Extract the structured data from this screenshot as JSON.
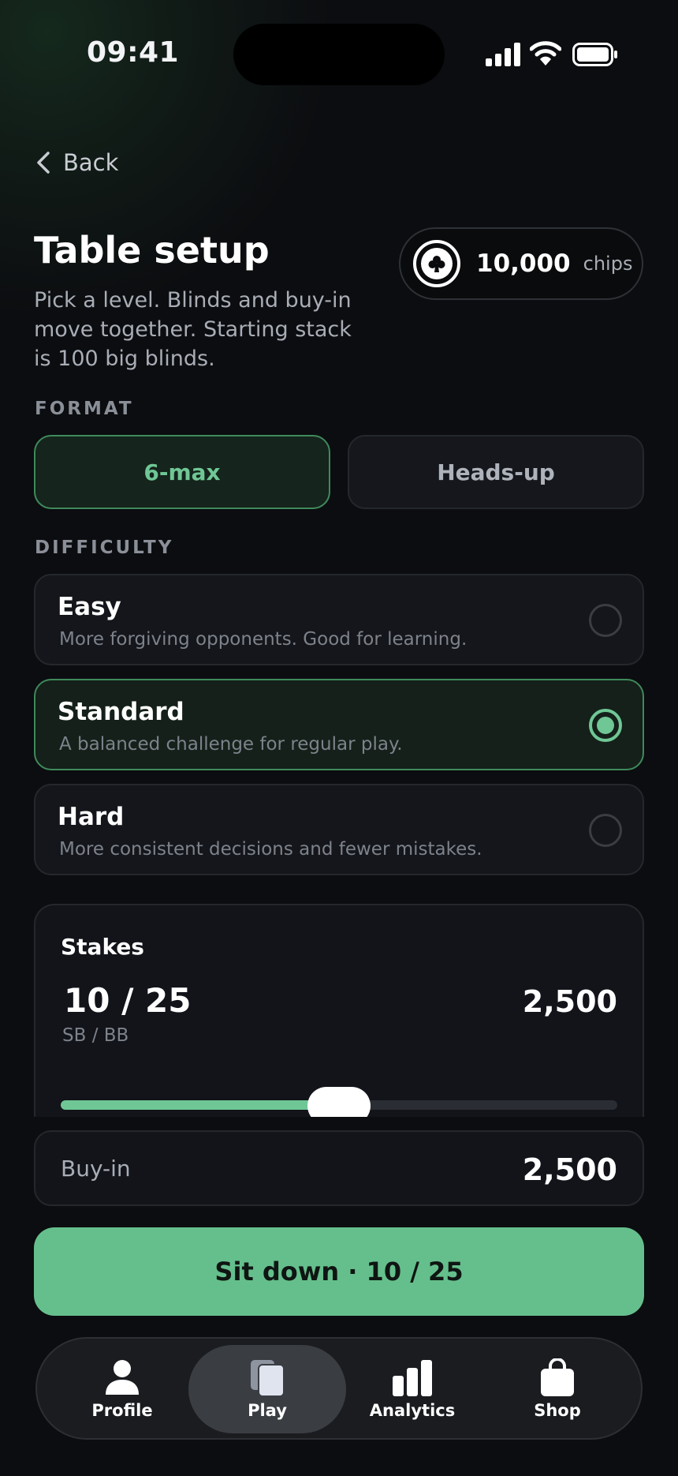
{
  "status_bar": {
    "time": "09:41"
  },
  "nav": {
    "back_label": "Back"
  },
  "header": {
    "title": "Table setup",
    "subtitle": "Pick a level. Blinds and buy-in move together. Starting stack is 100 big blinds.",
    "chips_value": "10,000",
    "chips_unit": "chips"
  },
  "format": {
    "section_label": "FORMAT",
    "options": [
      {
        "label": "6-max",
        "selected": true
      },
      {
        "label": "Heads-up",
        "selected": false
      }
    ]
  },
  "difficulty": {
    "section_label": "DIFFICULTY",
    "options": [
      {
        "name": "Easy",
        "description": "More forgiving opponents. Good for learning.",
        "selected": false
      },
      {
        "name": "Standard",
        "description": "A balanced challenge for regular play.",
        "selected": true
      },
      {
        "name": "Hard",
        "description": "More consistent decisions and fewer mistakes.",
        "selected": false
      }
    ]
  },
  "stakes": {
    "label": "Stakes",
    "value": "10 / 25",
    "sub_label": "SB / BB",
    "amount": "2,500",
    "slider_fraction": 0.5
  },
  "buy_in": {
    "label": "Buy-in",
    "value": "2,500"
  },
  "cta": {
    "label": "Sit down · 10 / 25"
  },
  "tabbar": {
    "items": [
      {
        "label": "Profile",
        "icon": "person-icon",
        "active": false
      },
      {
        "label": "Play",
        "icon": "cards-icon",
        "active": true
      },
      {
        "label": "Analytics",
        "icon": "bar-chart-icon",
        "active": false
      },
      {
        "label": "Shop",
        "icon": "shopping-bag-icon",
        "active": false
      }
    ]
  },
  "colors": {
    "accent": "#6fc795",
    "cta": "#65bf8c",
    "background": "#0c0d10"
  }
}
